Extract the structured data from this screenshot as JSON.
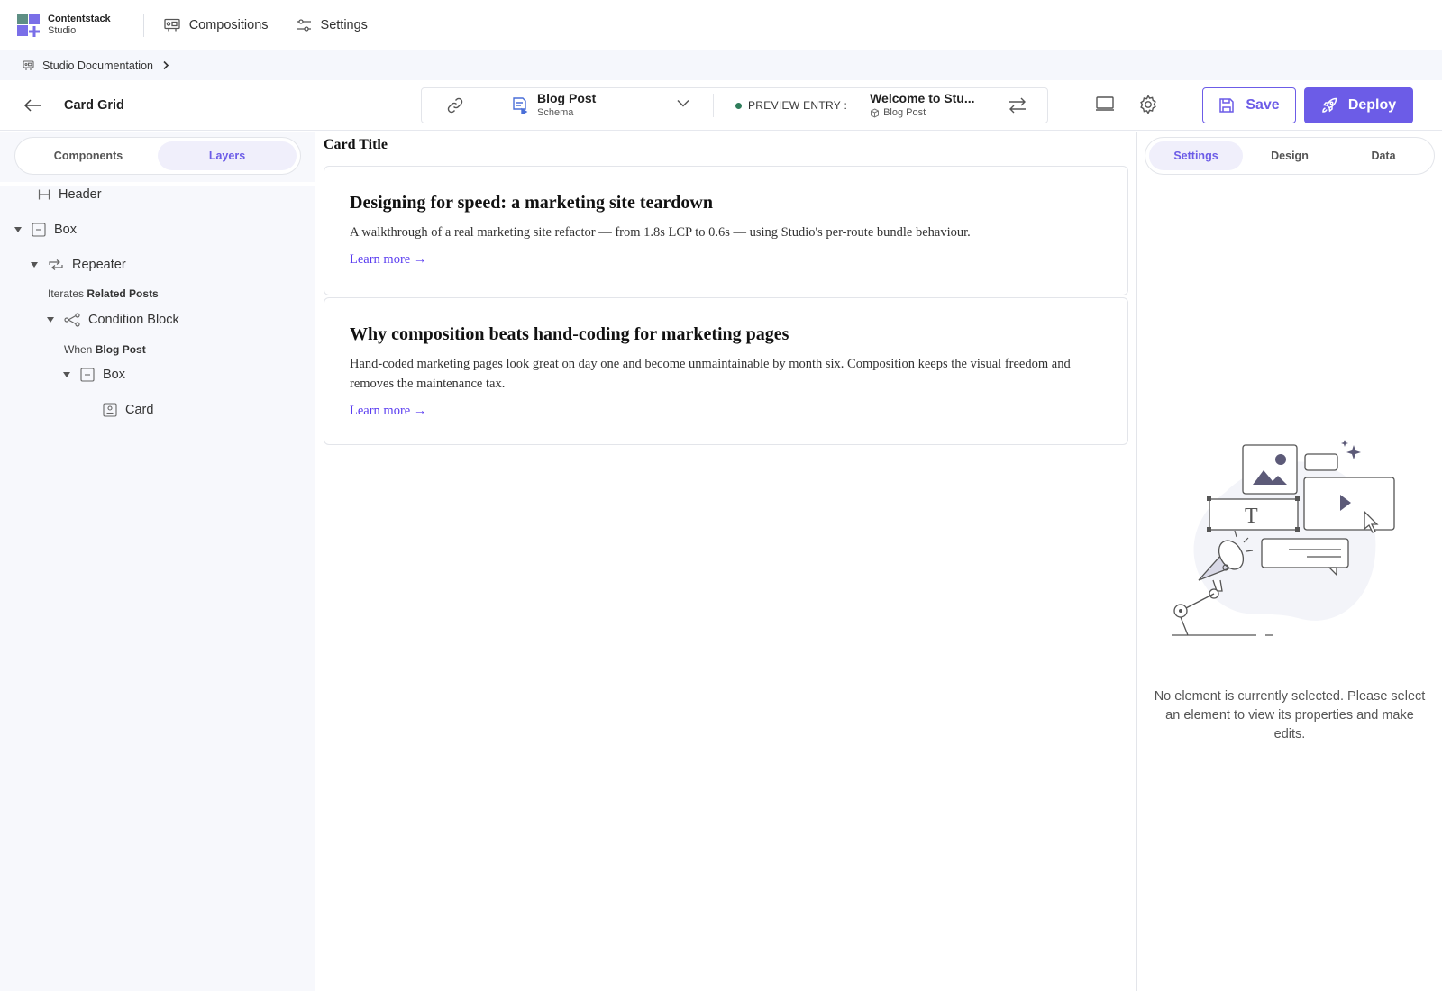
{
  "app": {
    "brand_line1": "Contentstack",
    "brand_line2": "Studio",
    "colors": {
      "accent": "#6c5ce7",
      "preview_dot": "#2f7d5b",
      "link": "#5a3df0"
    }
  },
  "topnav": {
    "items": [
      {
        "label": "Compositions",
        "icon": "compositions-icon"
      },
      {
        "label": "Settings",
        "icon": "sliders-icon"
      }
    ]
  },
  "breadcrumb": {
    "project": "Studio Documentation"
  },
  "toolbar": {
    "page_name": "Card Grid",
    "schema_title": "Blog Post",
    "schema_subtitle": "Schema",
    "preview_label": "PREVIEW ENTRY :",
    "preview_entry_title": "Welcome to Stu...",
    "preview_entry_type": "Blog Post",
    "save_label": "Save",
    "deploy_label": "Deploy"
  },
  "left_panel": {
    "tabs": [
      {
        "label": "Components",
        "active": false
      },
      {
        "label": "Layers",
        "active": true
      }
    ],
    "layers": [
      {
        "label": "Header",
        "icon": "header-icon"
      },
      {
        "label": "Box",
        "icon": "box-icon"
      },
      {
        "label": "Repeater",
        "icon": "repeater-icon",
        "sub_prefix": "Iterates",
        "sub_value": "Related Posts"
      },
      {
        "label": "Condition Block",
        "icon": "condition-icon",
        "sub_prefix": "When",
        "sub_value": "Blog Post"
      },
      {
        "label": "Box",
        "icon": "box-icon"
      },
      {
        "label": "Card",
        "icon": "card-icon"
      }
    ]
  },
  "canvas": {
    "heading": "Card Title",
    "cards": [
      {
        "title": "Designing for speed: a marketing site teardown",
        "body": "A walkthrough of a real marketing site refactor — from 1.8s LCP to 0.6s — using Studio's per-route bundle behaviour.",
        "link": "Learn more →"
      },
      {
        "title": "Why composition beats hand-coding for marketing pages",
        "body": "Hand-coded marketing pages look great on day one and become unmaintainable by month six. Composition keeps the visual freedom and removes the maintenance tax.",
        "link": "Learn more →"
      }
    ]
  },
  "right_panel": {
    "tabs": [
      {
        "label": "Settings",
        "active": true
      },
      {
        "label": "Design",
        "active": false
      },
      {
        "label": "Data",
        "active": false
      }
    ],
    "empty_message": "No element is currently selected. Please select an element to view its properties and make edits.",
    "illustration_glyph": "T"
  }
}
